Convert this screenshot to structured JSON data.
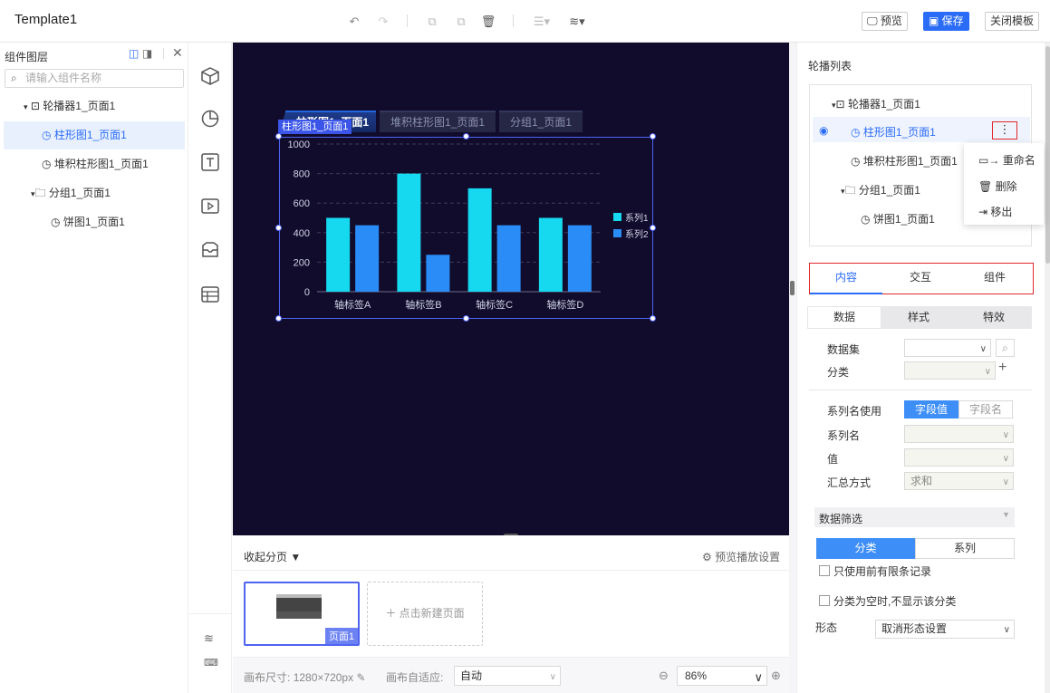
{
  "app": {
    "title": "Template1"
  },
  "toolbar": {
    "preview_label": "预览",
    "save_label": "保存",
    "close_label": "关闭模板"
  },
  "layers": {
    "title": "组件图层",
    "search_placeholder": "请输入组件名称",
    "items": [
      {
        "label": "轮播器1_页面1"
      },
      {
        "label": "柱形图1_页面1"
      },
      {
        "label": "堆积柱形图1_页面1"
      },
      {
        "label": "分组1_页面1"
      },
      {
        "label": "饼图1_页面1"
      }
    ]
  },
  "canvas": {
    "carousel_tabs": [
      {
        "label": "柱形图1_页面1"
      },
      {
        "label": "堆积柱形图1_页面1"
      },
      {
        "label": "分组1_页面1"
      }
    ],
    "selected_badge": "柱形图1_页面1"
  },
  "chart_data": {
    "type": "bar",
    "categories": [
      "轴标签A",
      "轴标签B",
      "轴标签C",
      "轴标签D"
    ],
    "series": [
      {
        "name": "系列1",
        "values": [
          500,
          800,
          700,
          500
        ],
        "color": "#16d9f0"
      },
      {
        "name": "系列2",
        "values": [
          450,
          250,
          450,
          450
        ],
        "color": "#2a8cf6"
      }
    ],
    "yticks": [
      0,
      200,
      400,
      600,
      800,
      1000
    ],
    "ylim": [
      0,
      1000
    ],
    "grid": true,
    "legend": "right"
  },
  "pages": {
    "collapse_label": "收起分页",
    "preview_settings_label": "预览播放设置",
    "page_label": "页面1",
    "add_page_label": "点击新建页面"
  },
  "footer": {
    "canvas_size_label": "画布尺寸:",
    "canvas_size_value": "1280×720px",
    "fit_label": "画布自适应:",
    "fit_value": "自动",
    "zoom_value": "86%"
  },
  "right": {
    "carousel_list_title": "轮播列表",
    "tree": [
      {
        "label": "轮播器1_页面1"
      },
      {
        "label": "柱形图1_页面1"
      },
      {
        "label": "堆积柱形图1_页面1"
      },
      {
        "label": "分组1_页面1"
      },
      {
        "label": "饼图1_页面1"
      }
    ],
    "context_menu": [
      {
        "label": "重命名"
      },
      {
        "label": "删除"
      },
      {
        "label": "移出"
      }
    ],
    "main_tabs": [
      {
        "label": "内容"
      },
      {
        "label": "交互"
      },
      {
        "label": "组件"
      }
    ],
    "sub_tabs": [
      {
        "label": "数据"
      },
      {
        "label": "样式"
      },
      {
        "label": "特效"
      }
    ],
    "dataset_label": "数据集",
    "category_label": "分类",
    "series_name_use_label": "系列名使用",
    "series_name_options": [
      "字段值",
      "字段名"
    ],
    "series_name_label": "系列名",
    "value_label": "值",
    "summary_label": "汇总方式",
    "summary_value": "求和",
    "filter_label": "数据筛选",
    "filter_tabs": [
      "分类",
      "系列"
    ],
    "limit_records_label": "只使用前有限条记录",
    "hide_empty_label": "分类为空时,不显示该分类",
    "form_label": "形态",
    "form_value": "取消形态设置"
  }
}
